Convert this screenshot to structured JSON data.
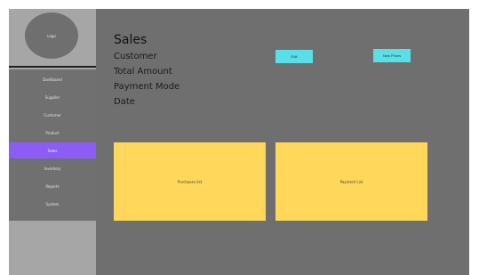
{
  "sidebar": {
    "logo_label": "Logo",
    "items": [
      {
        "label": "Dashboard"
      },
      {
        "label": "Supplier"
      },
      {
        "label": "Customer"
      },
      {
        "label": "Product"
      },
      {
        "label": "Sales"
      },
      {
        "label": "Inventory"
      },
      {
        "label": "Reports"
      },
      {
        "label": "System"
      }
    ]
  },
  "main": {
    "title": "Sales",
    "fields": [
      "Customer",
      "Total Amount",
      "Payment Mode",
      "Date"
    ],
    "buttons": {
      "edit": "Edit",
      "new_prices": "New Prices"
    },
    "panels": {
      "purchases": "Purchases list",
      "payment": "Payment List"
    }
  }
}
